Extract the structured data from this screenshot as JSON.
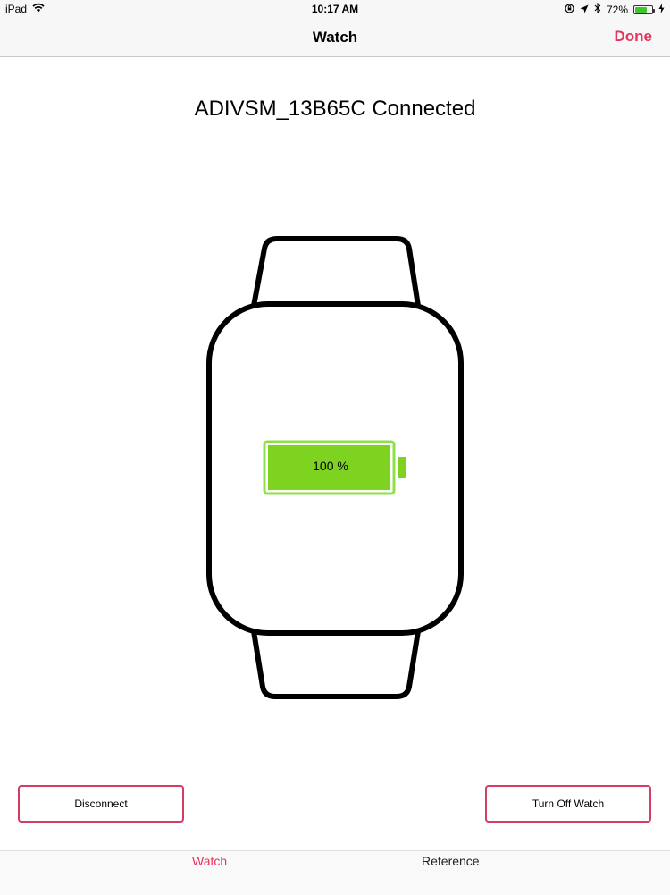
{
  "status_bar": {
    "device": "iPad",
    "time": "10:17 AM",
    "battery_percent": "72%",
    "battery_level": 0.72,
    "icons": [
      "wifi-icon",
      "orientation-lock-icon",
      "location-icon",
      "bluetooth-icon",
      "battery-icon",
      "charging-icon"
    ]
  },
  "nav": {
    "title": "Watch",
    "done_label": "Done"
  },
  "main": {
    "device_status": "ADIVSM_13B65C Connected",
    "watch_battery_label": "100 %",
    "watch_battery_level": 1.0
  },
  "actions": {
    "disconnect_label": "Disconnect",
    "turn_off_label": "Turn Off Watch"
  },
  "tabs": [
    {
      "label": "Watch",
      "selected": true
    },
    {
      "label": "Reference",
      "selected": false
    }
  ],
  "colors": {
    "accent": "#e8335e",
    "button_border": "#d63b63",
    "battery_green": "#7ed321",
    "battery_border": "#8ee04a"
  }
}
